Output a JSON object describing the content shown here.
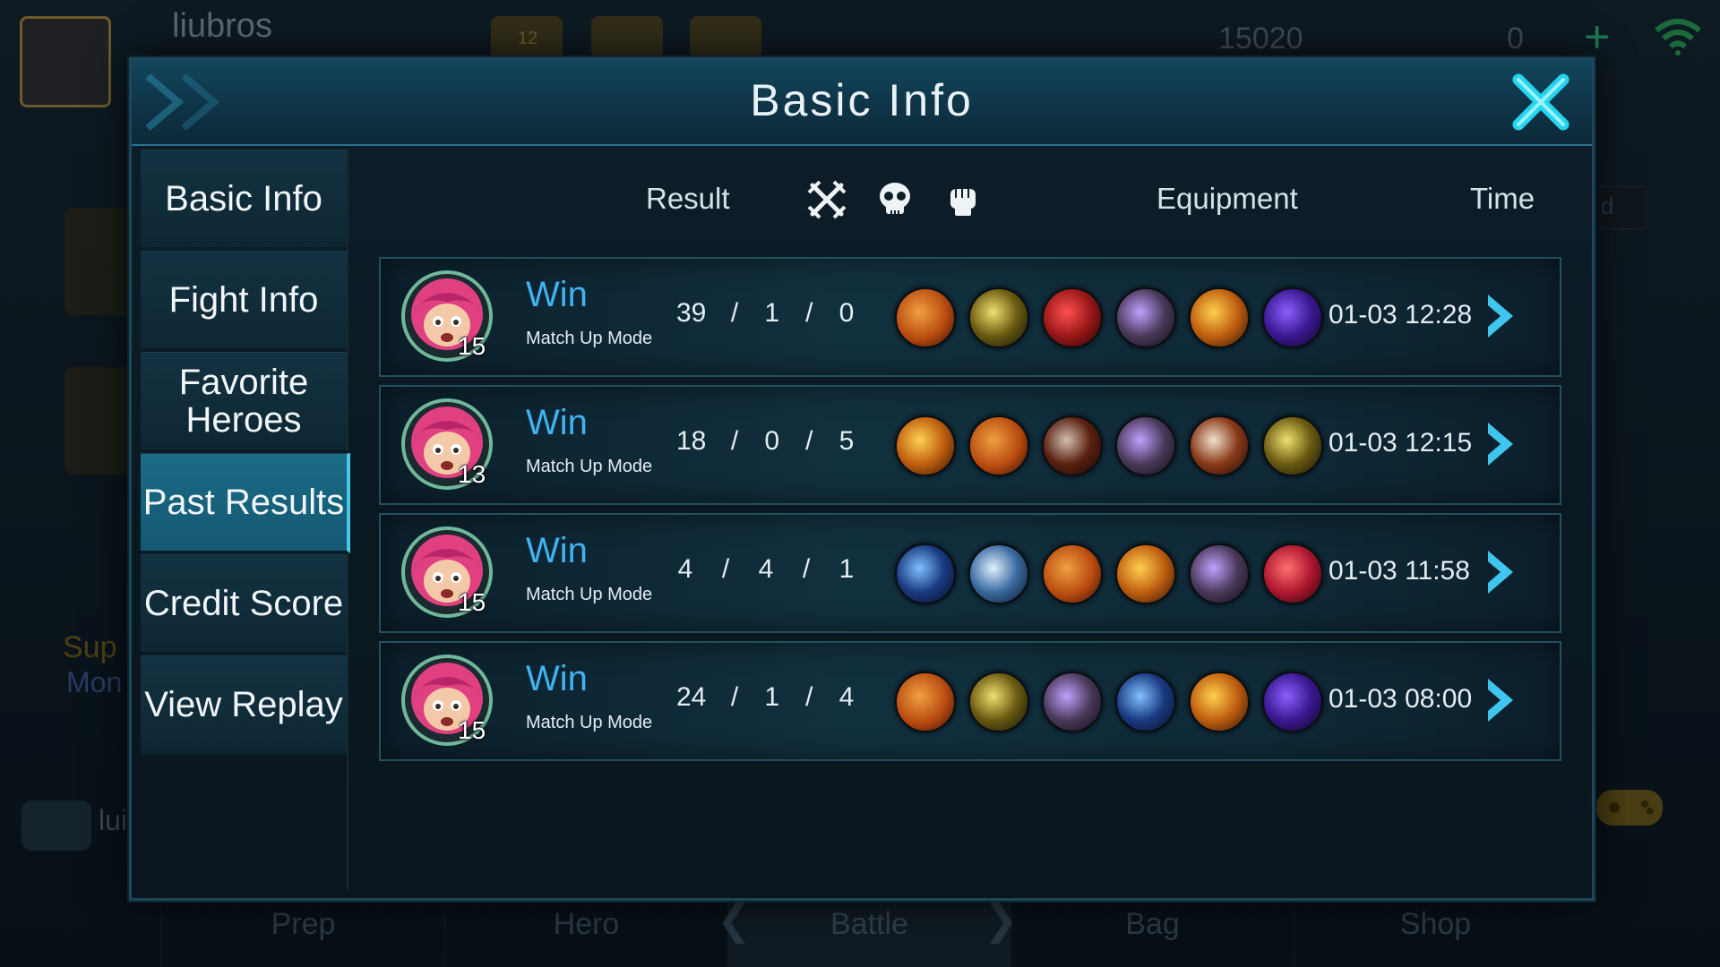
{
  "background": {
    "player_name": "liubros",
    "rank_number": "12",
    "currency_1": "15020",
    "currency_2": "0",
    "chat_name": "lui",
    "side_promo": "Sup",
    "side_promo2": "Mon",
    "right_label": "d",
    "bottom_nav": [
      "Prep",
      "Hero",
      "Battle",
      "Bag",
      "Shop"
    ]
  },
  "dialog": {
    "title": "Basic Info",
    "sidebar": [
      "Basic Info",
      "Fight Info",
      "Favorite Heroes",
      "Past Results",
      "Credit Score",
      "View Replay"
    ],
    "active_tab": "Past Results",
    "columns": {
      "result": "Result",
      "kills_icon": "crossed-swords-icon",
      "deaths_icon": "skull-icon",
      "assists_icon": "fist-icon",
      "equipment": "Equipment",
      "time": "Time"
    },
    "matches": [
      {
        "hero_level": "15",
        "result": "Win",
        "mode": "Match Up Mode",
        "kills": "39",
        "deaths": "1",
        "assists": "0",
        "items": [
          "boots-icon",
          "golden-staff-icon",
          "red-blade-icon",
          "spiked-armor-icon",
          "golden-sword-icon",
          "purple-claw-icon"
        ],
        "time": "01-03 12:28"
      },
      {
        "hero_level": "13",
        "result": "Win",
        "mode": "Match Up Mode",
        "kills": "18",
        "deaths": "0",
        "assists": "5",
        "items": [
          "golden-sword-icon",
          "boots-icon",
          "dark-axe-icon",
          "spiked-armor-icon",
          "scythe-icon",
          "golden-staff-icon"
        ],
        "time": "01-03 12:15"
      },
      {
        "hero_level": "15",
        "result": "Win",
        "mode": "Match Up Mode",
        "kills": "4",
        "deaths": "4",
        "assists": "1",
        "items": [
          "blue-blade-icon",
          "silver-sword-icon",
          "boots-icon",
          "golden-sword-icon",
          "spiked-armor-icon",
          "red-claw-icon"
        ],
        "time": "01-03 11:58"
      },
      {
        "hero_level": "15",
        "result": "Win",
        "mode": "Match Up Mode",
        "kills": "24",
        "deaths": "1",
        "assists": "4",
        "items": [
          "boots-icon",
          "golden-staff-icon",
          "spiked-armor-icon",
          "blue-blade-icon",
          "golden-sword-icon",
          "purple-claw-icon"
        ],
        "time": "01-03 08:00"
      }
    ]
  },
  "colors": {
    "accent_cyan": "#46c8e8",
    "win_blue": "#3fb2f0",
    "panel_dark": "#0a1820"
  }
}
